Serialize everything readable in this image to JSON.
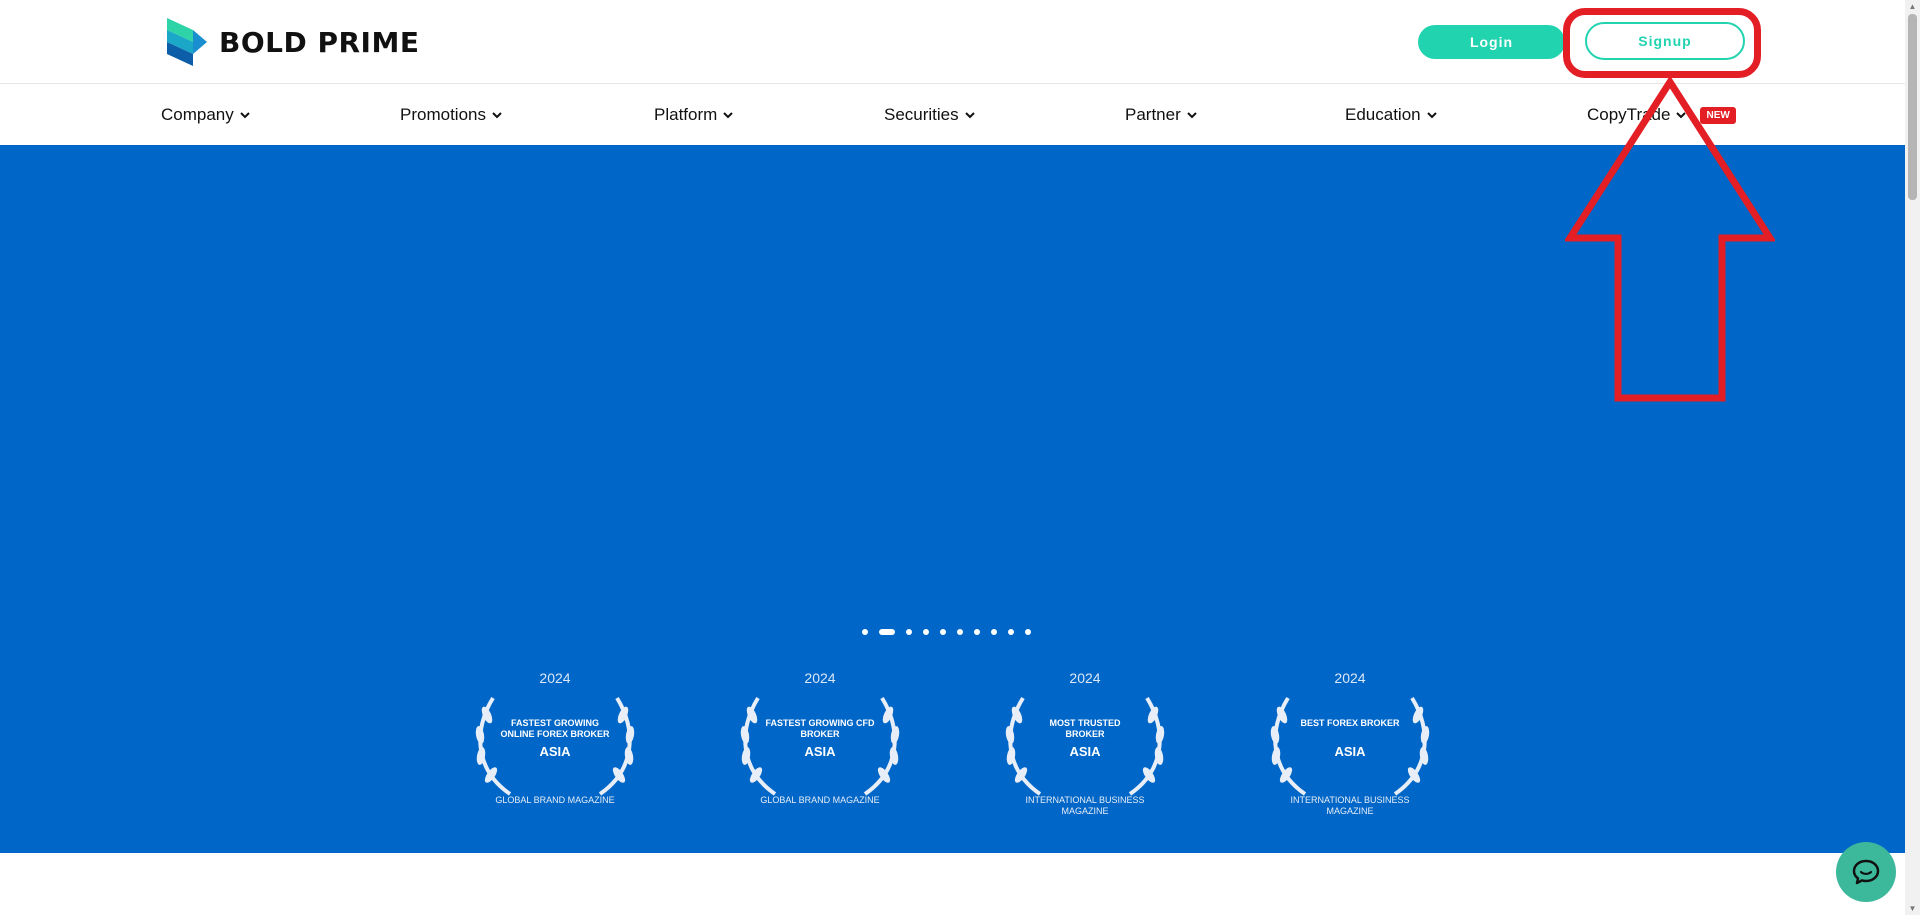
{
  "brand": {
    "name": "BOLD PRIME"
  },
  "header": {
    "login_label": "Login",
    "signup_label": "Signup"
  },
  "nav": {
    "items": [
      {
        "label": "Company"
      },
      {
        "label": "Promotions"
      },
      {
        "label": "Platform"
      },
      {
        "label": "Securities"
      },
      {
        "label": "Partner"
      },
      {
        "label": "Education"
      },
      {
        "label": "CopyTrade",
        "badge": "NEW"
      }
    ]
  },
  "carousel": {
    "slide_count": 10,
    "active_index": 1
  },
  "awards": [
    {
      "year": "2024",
      "title": "FASTEST GROWING ONLINE FOREX BROKER",
      "region": "ASIA",
      "source": "GLOBAL BRAND MAGAZINE"
    },
    {
      "year": "2024",
      "title": "FASTEST GROWING CFD BROKER",
      "region": "ASIA",
      "source": "GLOBAL BRAND MAGAZINE"
    },
    {
      "year": "2024",
      "title": "MOST TRUSTED BROKER",
      "region": "ASIA",
      "source": "INTERNATIONAL BUSINESS MAGAZINE"
    },
    {
      "year": "2024",
      "title": "BEST FOREX BROKER",
      "region": "ASIA",
      "source": "INTERNATIONAL BUSINESS MAGAZINE"
    }
  ],
  "colors": {
    "accent": "#22d3b0",
    "hero_bg": "#0066c7",
    "annotation": "#e31e24",
    "badge": "#e31e24",
    "chat": "#3cb89a"
  },
  "icons": {
    "nav_chevron": "chevron-down-icon",
    "chat": "chat-bubble-icon",
    "logo": "bold-prime-logo-mark"
  }
}
